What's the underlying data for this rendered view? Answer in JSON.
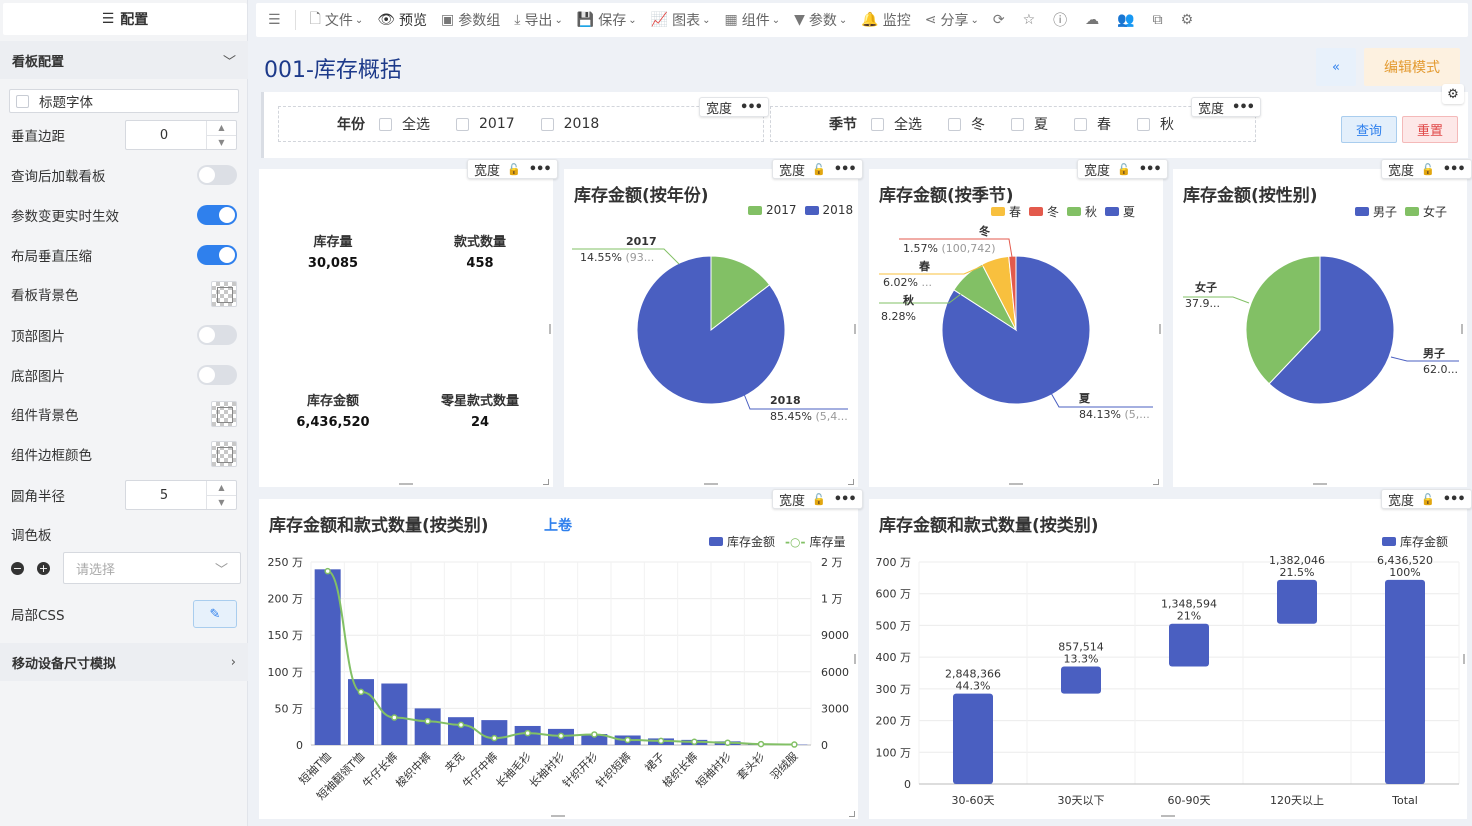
{
  "sidebar": {
    "header": "配置",
    "section_board": "看板配置",
    "title_font": "标题字体",
    "vertical_margin_label": "垂直边距",
    "vertical_margin_value": "0",
    "load_after_query": "查询后加载看板",
    "param_realtime": "参数变更实时生效",
    "layout_compress": "布局垂直压缩",
    "board_bg": "看板背景色",
    "top_image": "顶部图片",
    "bottom_image": "底部图片",
    "widget_bg": "组件背景色",
    "widget_border": "组件边框颜色",
    "radius_label": "圆角半径",
    "radius_value": "5",
    "palette_label": "调色板",
    "palette_placeholder": "请选择",
    "local_css": "局部CSS",
    "section_mobile": "移动设备尺寸模拟"
  },
  "toolbar": {
    "file": "文件",
    "preview": "预览",
    "param_group": "参数组",
    "export": "导出",
    "save": "保存",
    "chart": "图表",
    "widget": "组件",
    "param": "参数",
    "monitor": "监控",
    "share": "分享"
  },
  "page": {
    "title": "001-库存概括",
    "edit_mode": "编辑模式"
  },
  "filters": {
    "year_label": "年份",
    "year_options": [
      "全选",
      "2017",
      "2018"
    ],
    "season_label": "季节",
    "season_options": [
      "全选",
      "冬",
      "夏",
      "春",
      "秋"
    ],
    "width_tag": "宽度",
    "query": "查询",
    "reset": "重置"
  },
  "kpis": {
    "stock_qty_label": "库存量",
    "stock_qty_value": "30,085",
    "style_count_label": "款式数量",
    "style_count_value": "458",
    "stock_amount_label": "库存金额",
    "stock_amount_value": "6,436,520",
    "zero_style_label": "零星款式数量",
    "zero_style_value": "24"
  },
  "colors": {
    "blue": "#4a5fc1",
    "green": "#82c065",
    "yellow": "#f8c03e",
    "red": "#e35a4c",
    "accent": "#2f80ed"
  },
  "chart_data": [
    {
      "type": "pie",
      "title": "库存金额(按年份)",
      "legend": [
        "2017",
        "2018"
      ],
      "slices": [
        {
          "name": "2017",
          "percent": 14.55,
          "label_value": "(93..."
        },
        {
          "name": "2018",
          "percent": 85.45,
          "label_value": "(5,4..."
        }
      ]
    },
    {
      "type": "pie",
      "title": "库存金额(按季节)",
      "legend": [
        "春",
        "冬",
        "秋",
        "夏"
      ],
      "slices": [
        {
          "name": "冬",
          "percent": 1.57,
          "label_value": "(100,742)"
        },
        {
          "name": "春",
          "percent": 6.02,
          "label_value": "..."
        },
        {
          "name": "秋",
          "percent": 8.28,
          "label_value": ""
        },
        {
          "name": "夏",
          "percent": 84.13,
          "label_value": "(5,..."
        }
      ]
    },
    {
      "type": "pie",
      "title": "库存金额(按性别)",
      "legend": [
        "男子",
        "女子"
      ],
      "slices": [
        {
          "name": "男子",
          "percent": 62.0,
          "label": "62.0..."
        },
        {
          "name": "女子",
          "percent": 37.9,
          "label": "37.9..."
        }
      ]
    },
    {
      "type": "bar",
      "title": "库存金额和款式数量(按类别)",
      "subtitle": "上卷",
      "categories": [
        "短袖T恤",
        "短袖翻领T恤",
        "牛仔长裤",
        "梭织中裤",
        "夹克",
        "牛仔中裤",
        "长袖毛衫",
        "长袖衬衫",
        "针织开衫",
        "针织短裤",
        "裙子",
        "梭织长裤",
        "短袖衬衫",
        "套头衫",
        "羽绒服"
      ],
      "series": [
        {
          "name": "库存金额",
          "type": "bar",
          "values": [
            2400000,
            900000,
            840000,
            500000,
            380000,
            340000,
            260000,
            220000,
            150000,
            130000,
            90000,
            70000,
            50000,
            12000,
            5000
          ]
        },
        {
          "name": "库存量",
          "type": "line",
          "values": [
            19000,
            5800,
            3000,
            2600,
            2200,
            750,
            1300,
            1000,
            1150,
            550,
            450,
            350,
            250,
            100,
            50
          ]
        }
      ],
      "y_ticks": [
        "250 万",
        "200 万",
        "150 万",
        "100 万",
        "50 万",
        "0"
      ],
      "y2_ticks": [
        "2 万",
        "1 万",
        "9000",
        "6000",
        "3000",
        "0"
      ],
      "ylim": [
        0,
        2500000
      ],
      "y2lim": [
        0,
        20000
      ]
    },
    {
      "type": "bar",
      "title": "库存金额和款式数量(按类别)",
      "legend": [
        "库存金额"
      ],
      "categories": [
        "30-60天",
        "30天以下",
        "60-90天",
        "120天以上",
        "Total"
      ],
      "bars": [
        {
          "category": "30-60天",
          "value": "2,848,366",
          "percent": "44.3%",
          "start": 0,
          "end": 2848366
        },
        {
          "category": "30天以下",
          "value": "857,514",
          "percent": "13.3%",
          "start": 2848366,
          "end": 3705880
        },
        {
          "category": "60-90天",
          "value": "1,348,594",
          "percent": "21%",
          "start": 3705880,
          "end": 5054474
        },
        {
          "category": "120天以上",
          "value": "1,382,046",
          "percent": "21.5%",
          "start": 5054474,
          "end": 6436520
        },
        {
          "category": "Total",
          "value": "6,436,520",
          "percent": "100%",
          "start": 0,
          "end": 6436520
        }
      ],
      "y_ticks": [
        "700 万",
        "600 万",
        "500 万",
        "400 万",
        "300 万",
        "200 万",
        "100 万",
        "0"
      ],
      "ylim": [
        0,
        7000000
      ]
    }
  ]
}
